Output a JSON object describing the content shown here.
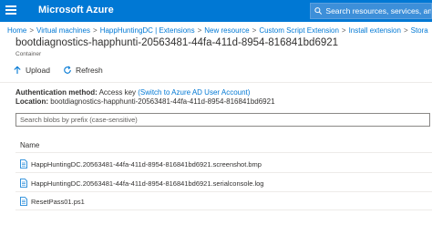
{
  "topbar": {
    "brand": "Microsoft Azure",
    "search_placeholder": "Search resources, services, and doc"
  },
  "breadcrumb": [
    "Home",
    "Virtual machines",
    "HappHuntingDC | Extensions",
    "New resource",
    "Custom Script Extension",
    "Install extension",
    "Stora"
  ],
  "page": {
    "title": "bootdiagnostics-happhunti-20563481-44fa-411d-8954-816841bd6921",
    "subtitle": "Container"
  },
  "toolbar": {
    "upload_label": "Upload",
    "refresh_label": "Refresh"
  },
  "info": {
    "auth_label": "Authentication method:",
    "auth_value": "Access key",
    "auth_link": "(Switch to Azure AD User Account)",
    "location_label": "Location:",
    "location_value": "bootdiagnostics-happhunti-20563481-44fa-411d-8954-816841bd6921"
  },
  "blob_search": {
    "placeholder": "Search blobs by prefix (case-sensitive)"
  },
  "table": {
    "column_name": "Name",
    "rows": [
      "HappHuntingDC.20563481-44fa-411d-8954-816841bd6921.screenshot.bmp",
      "HappHuntingDC.20563481-44fa-411d-8954-816841bd6921.serialconsole.log",
      "ResetPass01.ps1"
    ]
  },
  "colors": {
    "azure_blue": "#0078d4",
    "link_blue": "#0078d4"
  }
}
